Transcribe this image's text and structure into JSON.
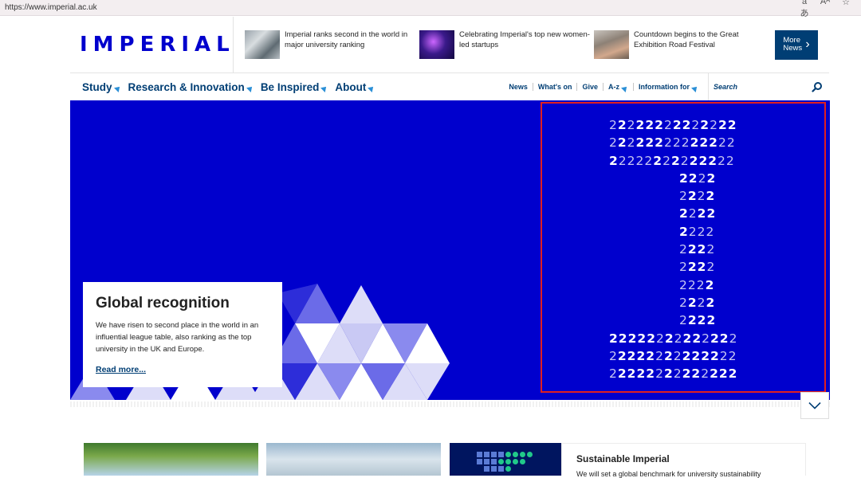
{
  "browser": {
    "url": "https://www.imperial.ac.uk",
    "icons": [
      "read-aloud-icon",
      "text-size-icon",
      "favorite-star-icon"
    ]
  },
  "header": {
    "logo": "IMPERIAL",
    "news": [
      {
        "text": "Imperial ranks second in the world in major university ranking"
      },
      {
        "text": "Celebrating Imperial's top new women-led startups"
      },
      {
        "text": "Countdown begins to the Great Exhibition Road Festival"
      }
    ],
    "more_news": "More News"
  },
  "nav": {
    "main": [
      "Study",
      "Research & Innovation",
      "Be Inspired",
      "About"
    ],
    "secondary": [
      {
        "label": "News"
      },
      {
        "label": "What's on"
      },
      {
        "label": "Give"
      },
      {
        "label": "A-z",
        "dropdown": true
      },
      {
        "label": "Information for",
        "dropdown": true
      }
    ],
    "search_placeholder": "Search"
  },
  "hero": {
    "title": "Global recognition",
    "body": "We have risen to second place in the world in an influential league table, also ranking as the top university in the UK and Europe.",
    "link": "Read more...",
    "pattern_rows": [
      "tbtbbbtbbtbtbb",
      "tbtbbbtttbbbtt",
      "bttttbtbtbbbtt",
      "bbtb",
      "tbtb",
      "btbb",
      "bttt",
      "tbbt",
      "tbbt",
      "tttb",
      "tbtb",
      "tbbb",
      "bbbbbtbtbbtbbt",
      "tbbbbtbtbbbbtt",
      "tbbbbtbtbbtbbb"
    ]
  },
  "tiles": {
    "sustainable_title": "Sustainable Imperial",
    "sustainable_text": "We will set a global benchmark for university sustainability"
  },
  "colors": {
    "imperial_blue": "#0000cd",
    "navy": "#003e74",
    "accent_triangle": "#2a8fd6",
    "annotation_red": "#e02020"
  }
}
